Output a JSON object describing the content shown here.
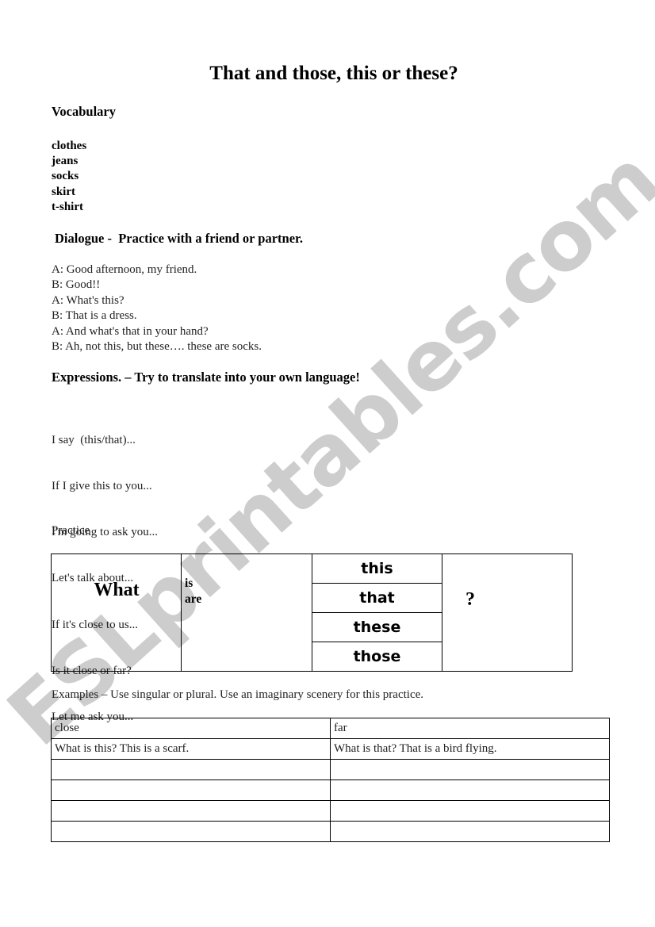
{
  "document": {
    "title": "That and those, this or these?",
    "watermark": "ESLprintables.com"
  },
  "vocabulary": {
    "heading": "Vocabulary",
    "items": [
      "clothes",
      "jeans",
      "socks",
      "skirt",
      "t-shirt"
    ]
  },
  "dialogue": {
    "heading": "Dialogue -  Practice with a friend or partner.",
    "lines": [
      "A: Good afternoon, my friend.",
      "B: Good!!",
      "A: What's this?",
      "B: That is a dress.",
      "A: And what's that in your hand?",
      "B: Ah, not this, but these…. these are socks."
    ]
  },
  "expressions": {
    "heading": "Expressions. – Try to translate into your own language!",
    "lines": [
      "I say  (this/that)...",
      "If I give this to you...",
      "I'm going to ask you...",
      "Let's talk about...",
      "If it's close to us...",
      "Is it close or far?",
      "Let me ask you..."
    ]
  },
  "practice": {
    "label": "Practice",
    "table": {
      "question_word": "What",
      "verbs": [
        "is",
        "are"
      ],
      "pronouns": [
        "this",
        "that",
        "these",
        "those"
      ],
      "end_mark": "?"
    }
  },
  "examples": {
    "instruction": "Examples – Use singular or plural. Use an imaginary scenery for this practice.",
    "headers": [
      "close",
      "far"
    ],
    "rows": [
      [
        "What is this? This is a scarf.",
        "What is that? That is a bird flying."
      ],
      [
        "",
        ""
      ],
      [
        "",
        ""
      ],
      [
        "",
        ""
      ],
      [
        "",
        ""
      ]
    ]
  }
}
